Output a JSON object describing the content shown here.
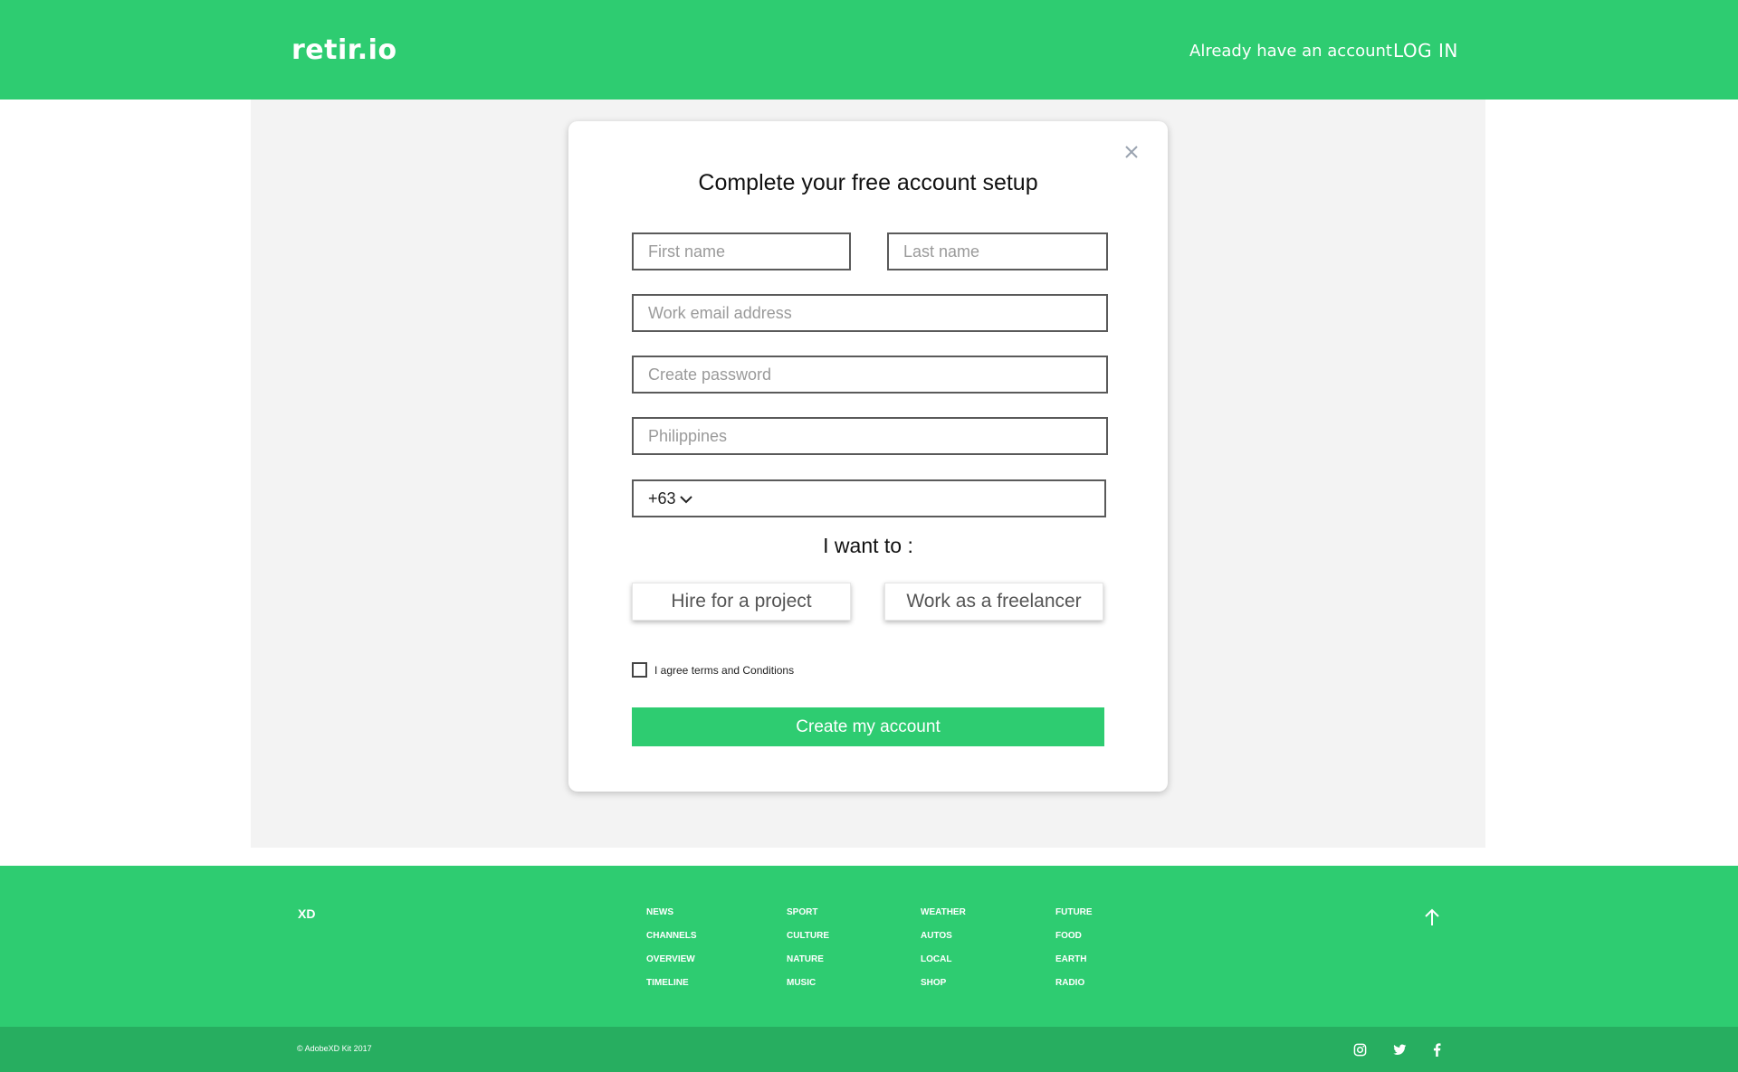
{
  "header": {
    "logo": "retir.io",
    "already_account": "Already have an account",
    "login": "LOG IN"
  },
  "modal": {
    "title": "Complete your free account setup",
    "fields": {
      "first_name_placeholder": "First name",
      "last_name_placeholder": "Last name",
      "email_placeholder": "Work email address",
      "password_placeholder": "Create password",
      "country_placeholder": "Philippines",
      "phone_code": "+63"
    },
    "want_label": "I want to :",
    "choices": {
      "hire": "Hire for a project",
      "freelance": "Work as a freelancer"
    },
    "agree_text": "I agree terms and Conditions",
    "create_button": "Create my account"
  },
  "footer": {
    "brand": "XD",
    "columns": [
      [
        "NEWS",
        "CHANNELS",
        "OVERVIEW",
        "TIMELINE"
      ],
      [
        "SPORT",
        "CULTURE",
        "NATURE",
        "MUSIC"
      ],
      [
        "WEATHER",
        "AUTOS",
        "LOCAL",
        "SHOP"
      ],
      [
        "FUTURE",
        "FOOD",
        "EARTH",
        "RADIO"
      ]
    ],
    "copyright": "© AdobeXD Kit 2017",
    "social_icons": [
      "instagram-icon",
      "twitter-icon",
      "facebook-icon"
    ]
  },
  "colors": {
    "brand_green": "#2ecc71",
    "dark_green": "#27ae60",
    "content_bg": "#f3f3f3"
  }
}
